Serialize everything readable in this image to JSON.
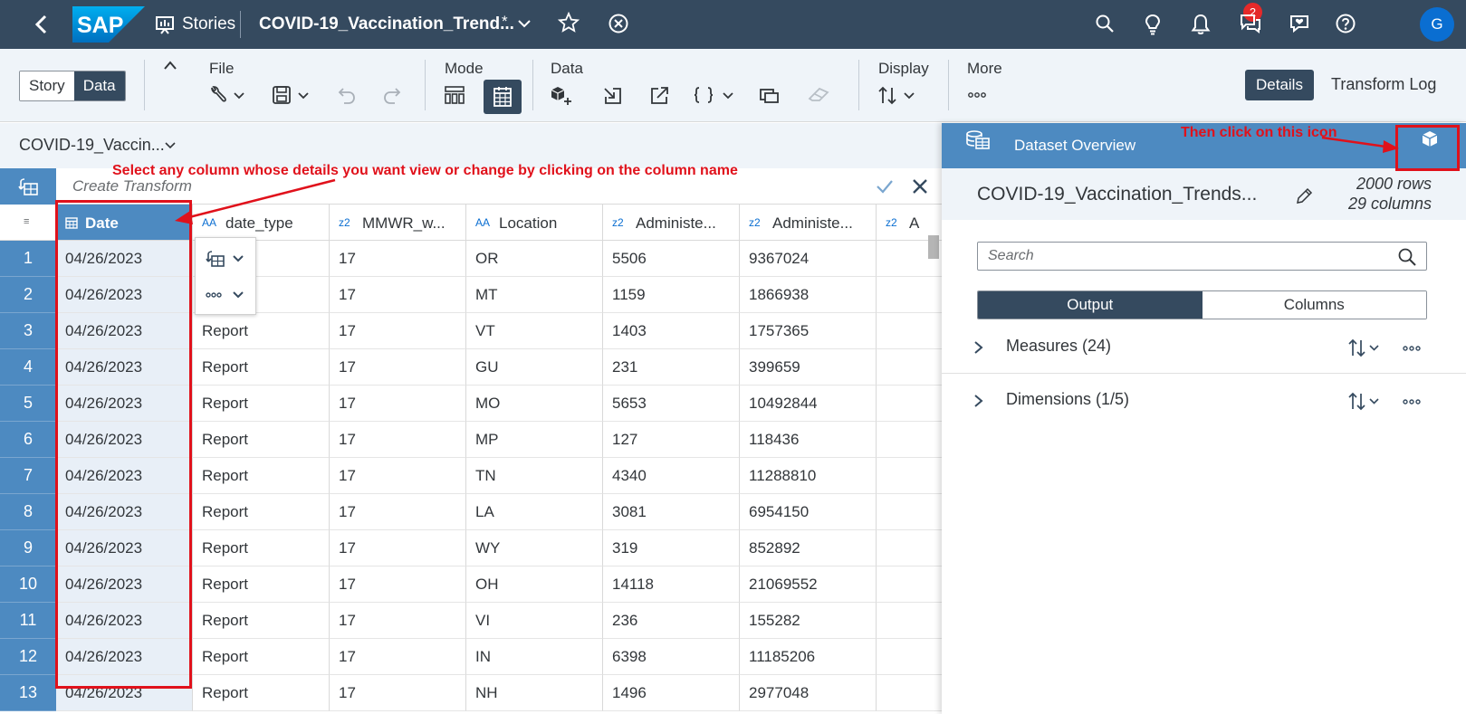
{
  "shellbar": {
    "logo": "SAP",
    "stories_label": "Stories",
    "doc_title": "COVID-19_Vaccination_Trend...",
    "dirty_marker": "*",
    "notification_count": "2",
    "avatar_initial": "G"
  },
  "toolbar": {
    "view_story": "Story",
    "view_data": "Data",
    "file_label": "File",
    "mode_label": "Mode",
    "data_label": "Data",
    "display_label": "Display",
    "more_label": "More",
    "details_label": "Details",
    "transform_log_label": "Transform Log"
  },
  "subheader": {
    "dataset_name": "COVID-19_Vaccin..."
  },
  "transform": {
    "placeholder": "Create Transform"
  },
  "grid": {
    "columns": [
      {
        "type": "date-icon",
        "name": "Date"
      },
      {
        "type": "AA",
        "name": "date_type"
      },
      {
        "type": "z2",
        "name": "MMWR_w..."
      },
      {
        "type": "AA",
        "name": "Location"
      },
      {
        "type": "z2",
        "name": "Administe..."
      },
      {
        "type": "z2",
        "name": "Administe..."
      },
      {
        "type": "z2",
        "name": "A"
      }
    ],
    "row_numbers": [
      "1",
      "2",
      "3",
      "4",
      "5",
      "6",
      "7",
      "8",
      "9",
      "10",
      "11",
      "12",
      "13"
    ],
    "rows": [
      [
        "04/26/2023",
        "",
        "17",
        "OR",
        "5506",
        "9367024"
      ],
      [
        "04/26/2023",
        "",
        "17",
        "MT",
        "1159",
        "1866938"
      ],
      [
        "04/26/2023",
        "Report",
        "17",
        "VT",
        "1403",
        "1757365"
      ],
      [
        "04/26/2023",
        "Report",
        "17",
        "GU",
        "231",
        "399659"
      ],
      [
        "04/26/2023",
        "Report",
        "17",
        "MO",
        "5653",
        "10492844"
      ],
      [
        "04/26/2023",
        "Report",
        "17",
        "MP",
        "127",
        "118436"
      ],
      [
        "04/26/2023",
        "Report",
        "17",
        "TN",
        "4340",
        "11288810"
      ],
      [
        "04/26/2023",
        "Report",
        "17",
        "LA",
        "3081",
        "6954150"
      ],
      [
        "04/26/2023",
        "Report",
        "17",
        "WY",
        "319",
        "852892"
      ],
      [
        "04/26/2023",
        "Report",
        "17",
        "OH",
        "14118",
        "21069552"
      ],
      [
        "04/26/2023",
        "Report",
        "17",
        "VI",
        "236",
        "155282"
      ],
      [
        "04/26/2023",
        "Report",
        "17",
        "IN",
        "6398",
        "11185206"
      ],
      [
        "04/26/2023",
        "Report",
        "17",
        "NH",
        "1496",
        "2977048"
      ]
    ]
  },
  "panel": {
    "header_title": "Dataset Overview",
    "dataset_name": "COVID-19_Vaccination_Trends...",
    "row_count": "2000 rows",
    "column_count": "29 columns",
    "search_placeholder": "Search",
    "tab_output": "Output",
    "tab_columns": "Columns",
    "measures_label": "Measures (24)",
    "dimensions_label": "Dimensions (1/5)"
  },
  "annotations": {
    "select_column": "Select any column whose details you want view or change by clicking on the column name",
    "click_icon": "Then click on this icon"
  },
  "colors": {
    "shell": "#354a5f",
    "header_blue": "#4d8ac1",
    "annotation_red": "#e0111b"
  }
}
